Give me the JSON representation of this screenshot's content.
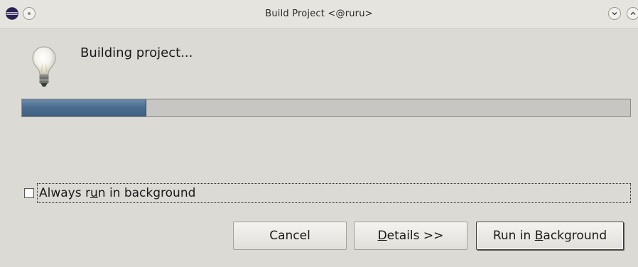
{
  "window": {
    "title": "Build Project  <@ruru>",
    "app_icon": "eclipse-icon",
    "controls": {
      "minimize_icon": "chevron-down-icon",
      "maximize_icon": "chevron-up-icon"
    }
  },
  "dialog": {
    "icon": "lightbulb-icon",
    "message": "Building project...",
    "progress": {
      "fraction": 0.205,
      "fill_color": "#4c6d8f"
    },
    "run_in_background_checkbox": {
      "label_pre": "Always r",
      "label_mnemonic": "u",
      "label_post": "n in background",
      "checked": false
    },
    "buttons": {
      "cancel": "Cancel",
      "details_mnemonic": "D",
      "details_rest": "etails >>",
      "run_pre": "Run in ",
      "run_mnemonic": "B",
      "run_post": "ackground"
    }
  }
}
